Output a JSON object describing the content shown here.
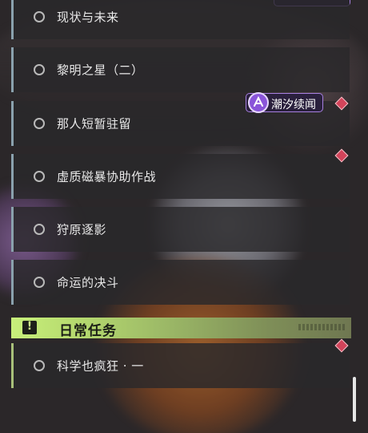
{
  "quests": [
    {
      "label": "现状与未来"
    },
    {
      "label": "黎明之星（二）"
    },
    {
      "label": "那人短暂驻留"
    },
    {
      "label": "虚质磁暴协助作战"
    },
    {
      "label": "狩原逐影"
    },
    {
      "label": "命运的决斗"
    }
  ],
  "event_tag": {
    "label": "潮汐续闻"
  },
  "daily_section": {
    "title": "日常任务"
  },
  "daily_quests": [
    {
      "label": "科学也疯狂 · 一"
    }
  ],
  "colors": {
    "accent_green": "#c8f07b",
    "marker_red": "#d2445a",
    "tag_purple": "#8a55d9"
  }
}
